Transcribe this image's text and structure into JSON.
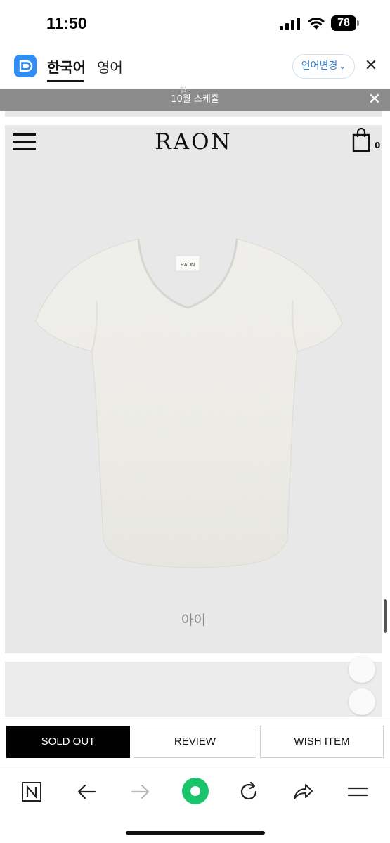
{
  "status_bar": {
    "time": "11:50",
    "battery": "78"
  },
  "translate_bar": {
    "lang_korean": "한국어",
    "lang_english": "영어",
    "change_language": "언어변경",
    "close": "✕"
  },
  "banner": {
    "text": "10월 스케줄",
    "peek_text": "헐 ·"
  },
  "header": {
    "brand": "RAON",
    "cart_count": "0"
  },
  "product": {
    "name": "아이",
    "tag_text": "RAON"
  },
  "actions": {
    "sold_out": "SOLD OUT",
    "review": "REVIEW",
    "wish_item": "WISH ITEM"
  },
  "toolbar": {
    "icons": [
      "naver-n-icon",
      "back-arrow-icon",
      "forward-arrow-icon",
      "green-circle-icon",
      "refresh-icon",
      "share-icon",
      "menu-icon"
    ]
  },
  "colors": {
    "card_background": "#e8e8e8",
    "banner": "#8c8c8c",
    "sold_out_button": "#000000",
    "language_accent": "#2e7fd0",
    "app_logo": "#2e8ef5",
    "green_button": "#19c46a"
  }
}
